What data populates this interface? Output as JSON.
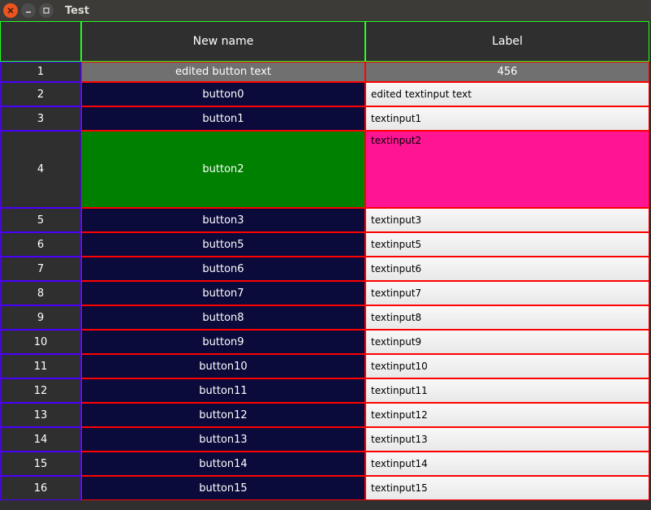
{
  "window": {
    "title": "Test"
  },
  "headers": {
    "col0": "",
    "col1": "New name",
    "col2": "Label"
  },
  "rows": [
    {
      "idx": "1",
      "button": "edited button text",
      "input": "456",
      "btn_style": "gray",
      "inp_style": "gray",
      "size": "first"
    },
    {
      "idx": "2",
      "button": "button0",
      "input": "edited textinput text",
      "btn_style": "navy",
      "inp_style": "light",
      "size": "normal"
    },
    {
      "idx": "3",
      "button": "button1",
      "input": "textinput1",
      "btn_style": "navy",
      "inp_style": "light",
      "size": "normal"
    },
    {
      "idx": "4",
      "button": "button2",
      "input": "textinput2",
      "btn_style": "green",
      "inp_style": "pink",
      "size": "big"
    },
    {
      "idx": "5",
      "button": "button3",
      "input": "textinput3",
      "btn_style": "navy",
      "inp_style": "light",
      "size": "normal"
    },
    {
      "idx": "6",
      "button": "button5",
      "input": "textinput5",
      "btn_style": "navy",
      "inp_style": "light",
      "size": "normal"
    },
    {
      "idx": "7",
      "button": "button6",
      "input": "textinput6",
      "btn_style": "navy",
      "inp_style": "light",
      "size": "normal"
    },
    {
      "idx": "8",
      "button": "button7",
      "input": "textinput7",
      "btn_style": "navy",
      "inp_style": "light",
      "size": "normal"
    },
    {
      "idx": "9",
      "button": "button8",
      "input": "textinput8",
      "btn_style": "navy",
      "inp_style": "light",
      "size": "normal"
    },
    {
      "idx": "10",
      "button": "button9",
      "input": "textinput9",
      "btn_style": "navy",
      "inp_style": "light",
      "size": "normal"
    },
    {
      "idx": "11",
      "button": "button10",
      "input": "textinput10",
      "btn_style": "navy",
      "inp_style": "light",
      "size": "normal"
    },
    {
      "idx": "12",
      "button": "button11",
      "input": "textinput11",
      "btn_style": "navy",
      "inp_style": "light",
      "size": "normal"
    },
    {
      "idx": "13",
      "button": "button12",
      "input": "textinput12",
      "btn_style": "navy",
      "inp_style": "light",
      "size": "normal"
    },
    {
      "idx": "14",
      "button": "button13",
      "input": "textinput13",
      "btn_style": "navy",
      "inp_style": "light",
      "size": "normal"
    },
    {
      "idx": "15",
      "button": "button14",
      "input": "textinput14",
      "btn_style": "navy",
      "inp_style": "light",
      "size": "normal"
    },
    {
      "idx": "16",
      "button": "button15",
      "input": "textinput15",
      "btn_style": "navy",
      "inp_style": "light",
      "size": "normal"
    }
  ]
}
